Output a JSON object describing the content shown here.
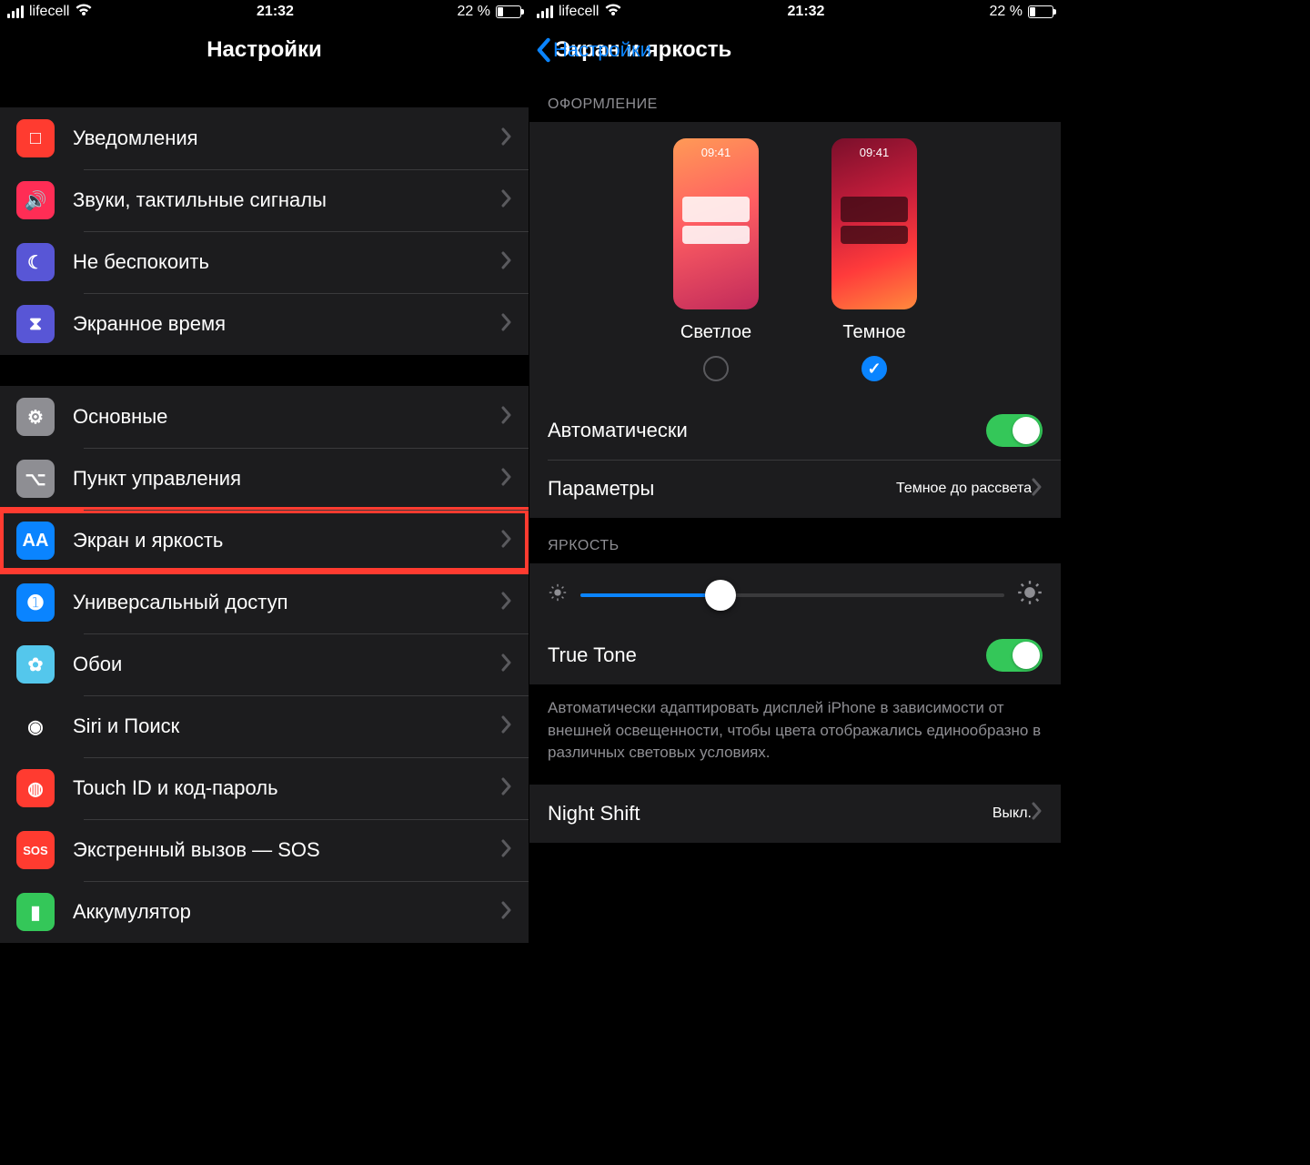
{
  "status": {
    "carrier": "lifecell",
    "time": "21:32",
    "battery_text": "22 %"
  },
  "left": {
    "title": "Настройки",
    "groups": [
      [
        {
          "id": "notifications",
          "label": "Уведомления",
          "icon_bg": "#ff3b30",
          "icon_glyph": "□"
        },
        {
          "id": "sounds",
          "label": "Звуки, тактильные сигналы",
          "icon_bg": "#ff2d55",
          "icon_glyph": "🔊"
        },
        {
          "id": "dnd",
          "label": "Не беспокоить",
          "icon_bg": "#5856d6",
          "icon_glyph": "☾"
        },
        {
          "id": "screentime",
          "label": "Экранное время",
          "icon_bg": "#5856d6",
          "icon_glyph": "⧗"
        }
      ],
      [
        {
          "id": "general",
          "label": "Основные",
          "icon_bg": "#8e8e93",
          "icon_glyph": "⚙"
        },
        {
          "id": "controlcenter",
          "label": "Пункт управления",
          "icon_bg": "#8e8e93",
          "icon_glyph": "⌥"
        },
        {
          "id": "display",
          "label": "Экран и яркость",
          "icon_bg": "#0a84ff",
          "icon_glyph": "AA",
          "highlight": true
        },
        {
          "id": "accessibility",
          "label": "Универсальный доступ",
          "icon_bg": "#0a84ff",
          "icon_glyph": "➊"
        },
        {
          "id": "wallpaper",
          "label": "Обои",
          "icon_bg": "#54c7ec",
          "icon_glyph": "✿"
        },
        {
          "id": "siri",
          "label": "Siri и Поиск",
          "icon_bg": "#1c1c1e",
          "icon_glyph": "◉"
        },
        {
          "id": "touchid",
          "label": "Touch ID и код-пароль",
          "icon_bg": "#ff3b30",
          "icon_glyph": "◍"
        },
        {
          "id": "emergency",
          "label": "Экстренный вызов — SOS",
          "icon_bg": "#ff3b30",
          "icon_glyph": "SOS"
        },
        {
          "id": "battery",
          "label": "Аккумулятор",
          "icon_bg": "#34c759",
          "icon_glyph": "▮"
        }
      ]
    ]
  },
  "right": {
    "back": "Настройки",
    "title": "Экран и яркость",
    "section_appearance": "ОФОРМЛЕНИЕ",
    "appearance": {
      "light": "Светлое",
      "dark": "Темное",
      "preview_time": "09:41",
      "selected": "dark"
    },
    "auto_label": "Автоматически",
    "options_label": "Параметры",
    "options_value": "Темное до рассвета",
    "section_brightness": "ЯРКОСТЬ",
    "brightness_value": 0.33,
    "truetone_label": "True Tone",
    "truetone_desc": "Автоматически адаптировать дисплей iPhone в зависимости от внешней освещенности, чтобы цвета отображались единообразно в различных световых условиях.",
    "nightshift_label": "Night Shift",
    "nightshift_value": "Выкл."
  }
}
